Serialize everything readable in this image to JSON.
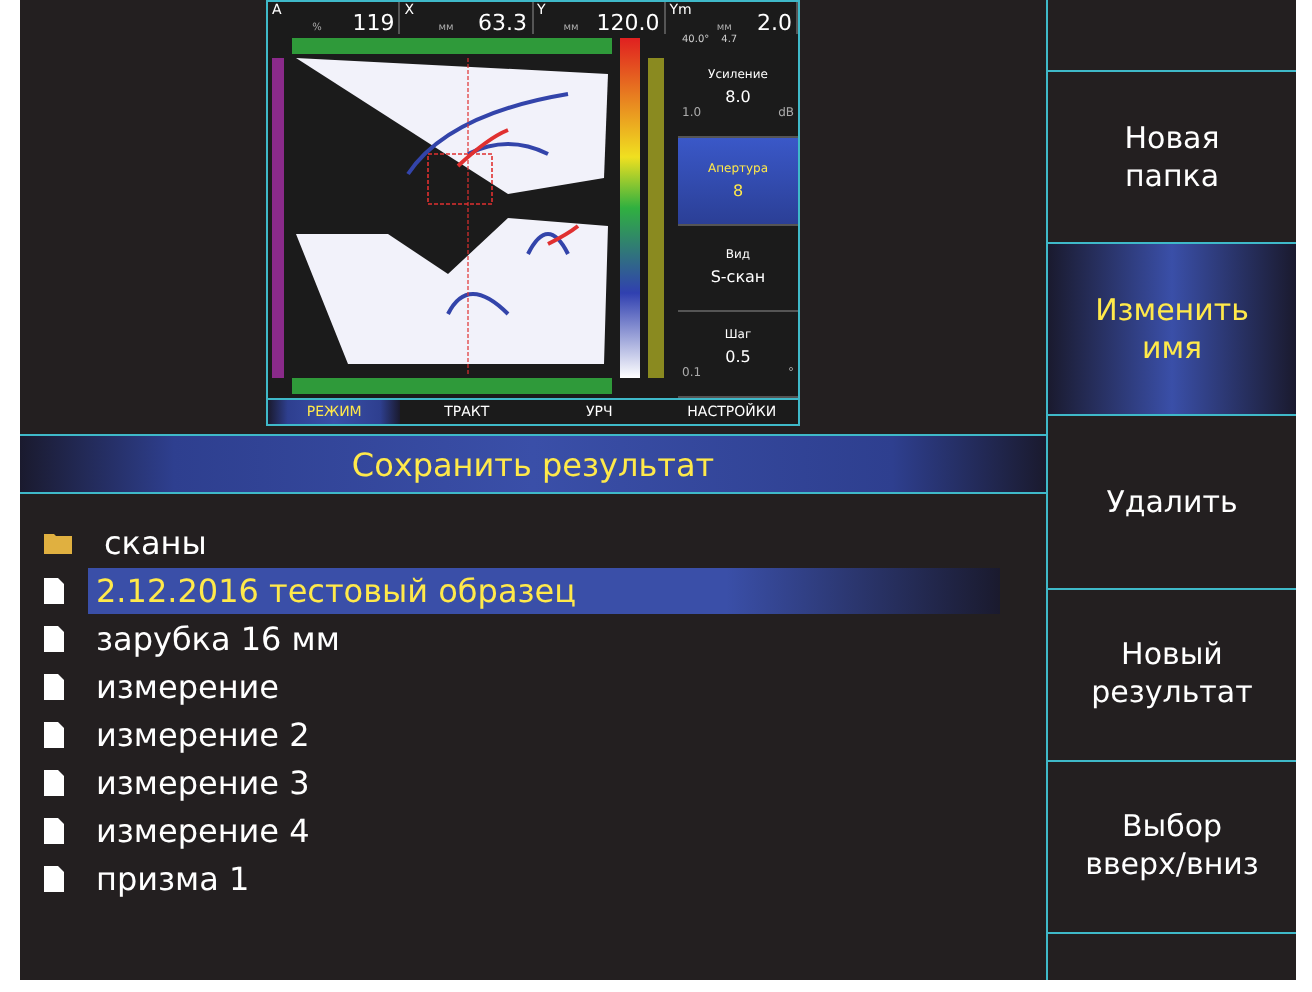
{
  "preview": {
    "readouts": [
      {
        "label": "A",
        "unit": "%",
        "value": "119"
      },
      {
        "label": "X",
        "unit": "мм",
        "value": "63.3"
      },
      {
        "label": "Y",
        "unit": "мм",
        "value": "120.0"
      },
      {
        "label": "Ym",
        "unit": "мм",
        "value": "2.0"
      }
    ],
    "status": [
      "40.0°",
      "4.7"
    ],
    "params": [
      {
        "label": "Усиление",
        "value": "8.0",
        "min": "1.0",
        "unit": "dB",
        "selected": false
      },
      {
        "label": "Апертура",
        "value": "8",
        "selected": true
      },
      {
        "label": "Вид",
        "value": "S-скан",
        "selected": false
      },
      {
        "label": "Шаг",
        "value": "0.5",
        "min": "0.1",
        "unit": "°",
        "selected": false
      }
    ],
    "tabs": [
      {
        "label": "РЕЖИМ",
        "selected": true
      },
      {
        "label": "ТРАКТ",
        "selected": false
      },
      {
        "label": "УРЧ",
        "selected": false
      },
      {
        "label": "НАСТРОЙКИ",
        "selected": false
      }
    ]
  },
  "header": "Сохранить результат",
  "files": [
    {
      "kind": "folder",
      "name": "сканы",
      "selected": false
    },
    {
      "kind": "file",
      "name": "2.12.2016 тестовый образец",
      "selected": true
    },
    {
      "kind": "file",
      "name": "зарубка 16 мм",
      "selected": false
    },
    {
      "kind": "file",
      "name": "измерение",
      "selected": false
    },
    {
      "kind": "file",
      "name": "измерение 2",
      "selected": false
    },
    {
      "kind": "file",
      "name": "измерение 3",
      "selected": false
    },
    {
      "kind": "file",
      "name": "измерение 4",
      "selected": false
    },
    {
      "kind": "file",
      "name": "призма 1",
      "selected": false
    }
  ],
  "softkeys": [
    {
      "label": "Новая\nпапка",
      "selected": false
    },
    {
      "label": "Изменить\nимя",
      "selected": true
    },
    {
      "label": "Удалить",
      "selected": false
    },
    {
      "label": "Новый\nрезультат",
      "selected": false
    },
    {
      "label": "Выбор\nвверх/вниз",
      "selected": false
    }
  ]
}
